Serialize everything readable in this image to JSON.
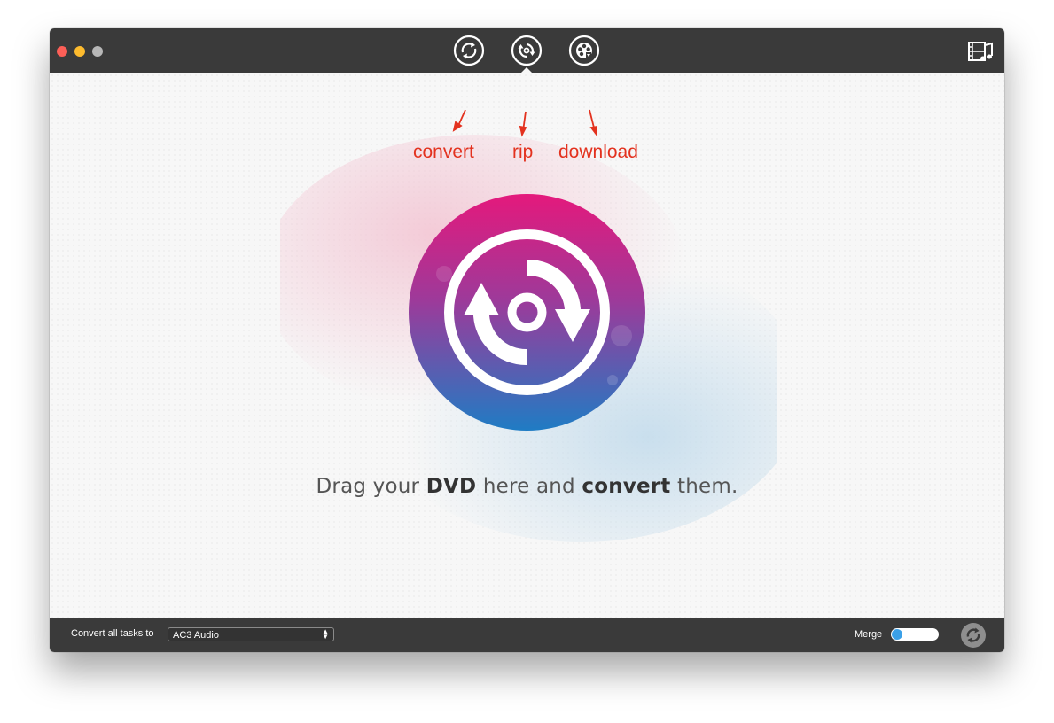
{
  "window": {
    "traffic_lights": [
      "close",
      "minimize",
      "zoom"
    ]
  },
  "toolbar": {
    "tools": [
      {
        "id": "convert",
        "icon": "convert-icon"
      },
      {
        "id": "rip",
        "icon": "rip-disc-icon",
        "active": true
      },
      {
        "id": "download",
        "icon": "download-film-icon"
      }
    ],
    "media_icon": "media-library-icon"
  },
  "annotations": {
    "convert": "convert",
    "rip": "rip",
    "download": "download",
    "color": "#e3321f"
  },
  "main": {
    "drop_icon": "rip-disc-icon",
    "drag_text": {
      "part1": "Drag your ",
      "bold1": "DVD",
      "part2": " here and ",
      "bold2": "convert",
      "part3": " them."
    }
  },
  "bottombar": {
    "convert_label": "Convert all tasks to",
    "format_value": "AC3 Audio",
    "merge_label": "Merge",
    "merge_on": false,
    "start_icon": "convert-start-icon"
  },
  "colors": {
    "titlebar": "#3a3a3a",
    "accent_pink": "#e4197c",
    "accent_blue": "#2a7fc4",
    "toggle_knob": "#3aa0e8"
  }
}
